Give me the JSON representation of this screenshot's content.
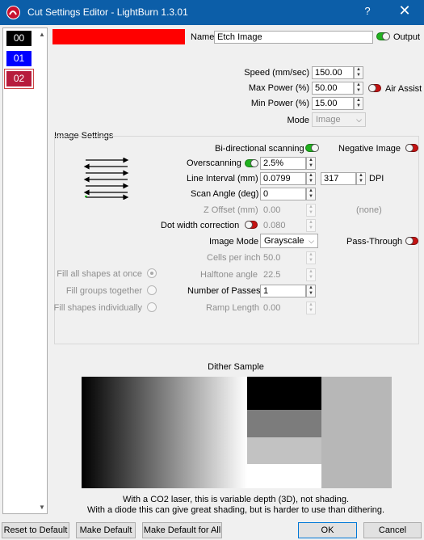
{
  "window": {
    "title": "Cut Settings Editor - LightBurn 1.3.01",
    "help": "?",
    "close": "✕"
  },
  "layers": [
    {
      "label": "00",
      "color": "#000000"
    },
    {
      "label": "01",
      "color": "#0000ff"
    },
    {
      "label": "02",
      "color": "#b71c3c"
    }
  ],
  "layer_color": "#ff0000",
  "name": {
    "label": "Name",
    "value": "Etch Image"
  },
  "output": {
    "label": "Output",
    "on": true
  },
  "speed": {
    "label": "Speed (mm/sec)",
    "value": "150.00"
  },
  "max_power": {
    "label": "Max Power (%)",
    "value": "50.00"
  },
  "air_assist": {
    "label": "Air Assist",
    "on": false
  },
  "min_power": {
    "label": "Min Power (%)",
    "value": "15.00"
  },
  "mode": {
    "label": "Mode",
    "value": "Image"
  },
  "image_settings": {
    "title": "Image Settings",
    "bidirectional": {
      "label": "Bi-directional scanning",
      "on": true
    },
    "negative_image": {
      "label": "Negative Image",
      "on": false
    },
    "overscanning": {
      "label": "Overscanning",
      "on": true,
      "value": "2.5%"
    },
    "line_interval": {
      "label": "Line Interval (mm)",
      "value": "0.0799",
      "dpi_value": "317",
      "dpi_label": "DPI"
    },
    "scan_angle": {
      "label": "Scan Angle (deg)",
      "value": "0"
    },
    "z_offset": {
      "label": "Z Offset (mm)",
      "value": "0.00",
      "note": "(none)"
    },
    "dot_width": {
      "label": "Dot width correction",
      "on": false,
      "value": "0.080"
    },
    "image_mode": {
      "label": "Image Mode",
      "value": "Grayscale"
    },
    "pass_through": {
      "label": "Pass-Through",
      "on": false
    },
    "cells_per_inch": {
      "label": "Cells per inch",
      "value": "50.0"
    },
    "halftone_angle": {
      "label": "Halftone angle",
      "value": "22.5"
    },
    "number_of_passes": {
      "label": "Number of Passes",
      "value": "1"
    },
    "ramp_length": {
      "label": "Ramp Length",
      "value": "0.00"
    },
    "fill_options": [
      {
        "label": "Fill all shapes at once",
        "checked": true
      },
      {
        "label": "Fill groups together",
        "checked": false
      },
      {
        "label": "Fill shapes individually",
        "checked": false
      }
    ]
  },
  "dither_sample": {
    "title": "Dither Sample",
    "note_line1": "With a CO2 laser, this is variable depth (3D), not shading.",
    "note_line2": "With a diode this can give great shading, but is harder to use than dithering."
  },
  "buttons": {
    "reset_default": "Reset to Default",
    "make_default": "Make Default",
    "make_default_all": "Make Default for All",
    "ok": "OK",
    "cancel": "Cancel"
  }
}
